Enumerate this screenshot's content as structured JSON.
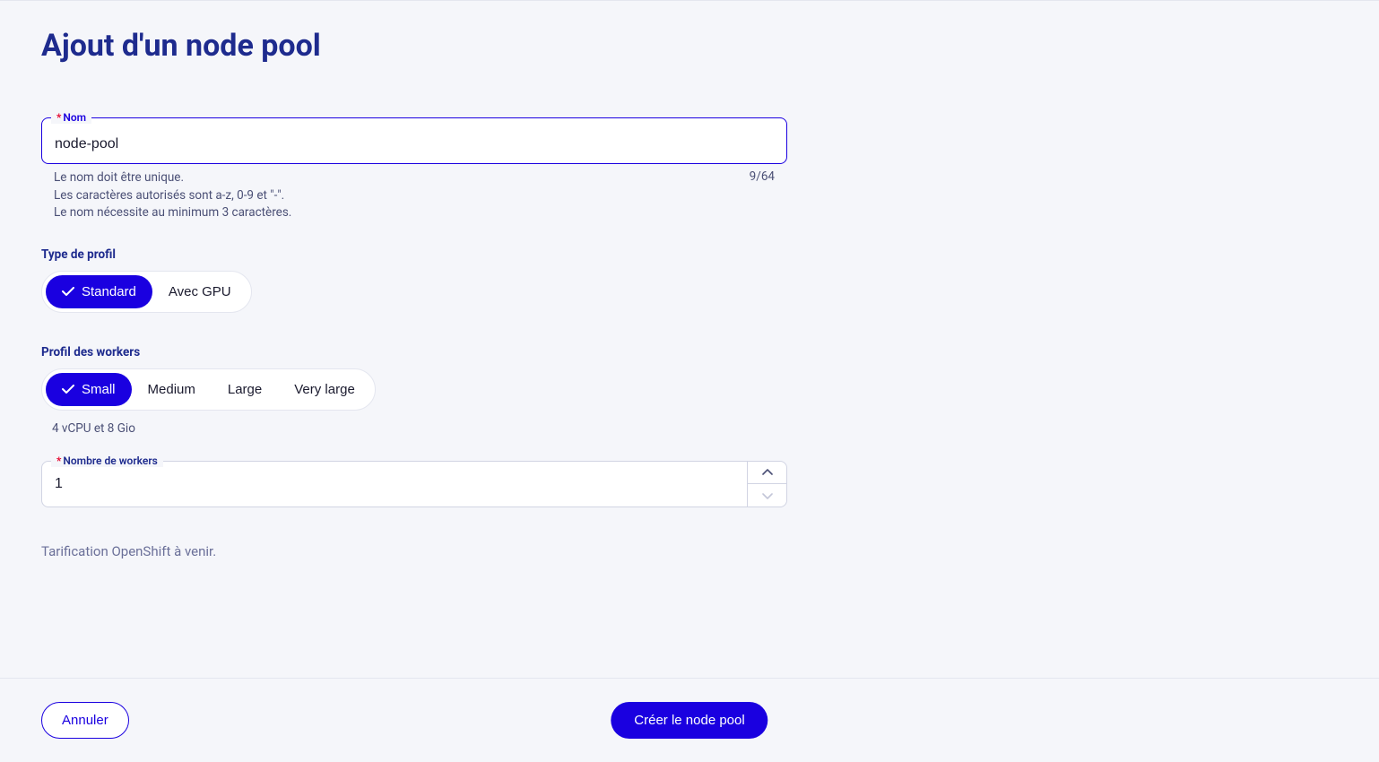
{
  "page_title": "Ajout d'un node pool",
  "name_field": {
    "label": "Nom",
    "value": "node-pool",
    "counter": "9/64",
    "help1": "Le nom doit être unique.",
    "help2": "Les caractères autorisés sont a-z, 0-9 et \"-\".",
    "help3": "Le nom nécessite au minimum 3 caractères."
  },
  "profile_type": {
    "label": "Type de profil",
    "options": {
      "standard": "Standard",
      "gpu": "Avec GPU"
    }
  },
  "worker_profile": {
    "label": "Profil des workers",
    "options": {
      "small": "Small",
      "medium": "Medium",
      "large": "Large",
      "very_large": "Very large"
    },
    "helper": "4 vCPU et 8 Gio"
  },
  "worker_count": {
    "label": "Nombre de workers",
    "value": "1"
  },
  "pricing_note": "Tarification OpenShift à venir.",
  "footer": {
    "cancel": "Annuler",
    "create": "Créer le node pool"
  }
}
